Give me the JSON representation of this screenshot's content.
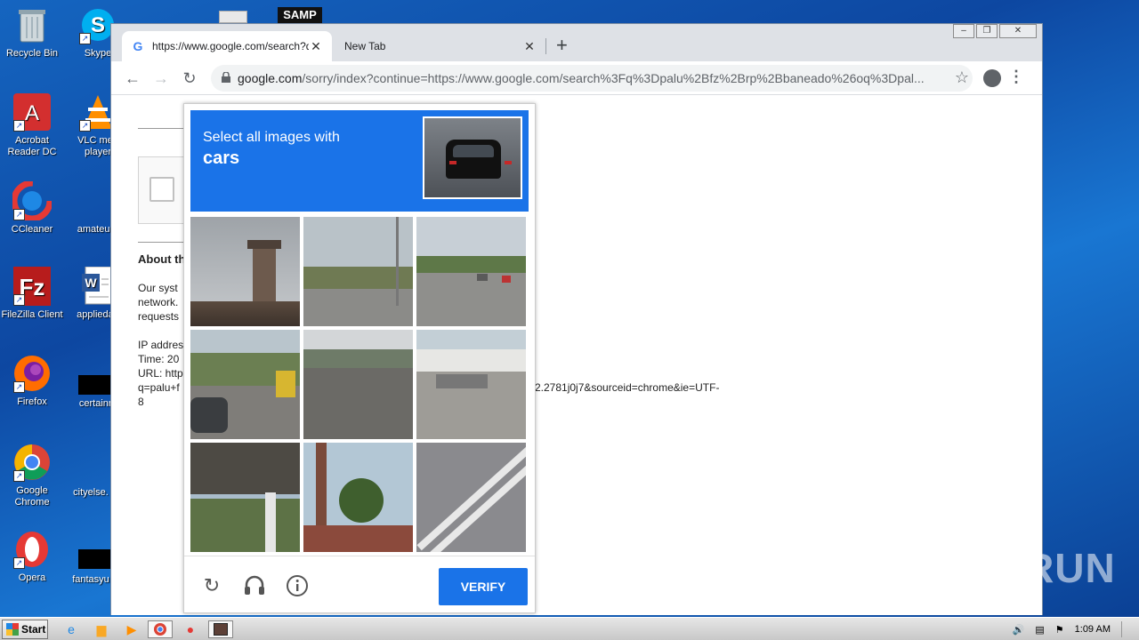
{
  "desktop": {
    "icons": [
      {
        "label": "Recycle Bin",
        "icon": "recycle-bin-icon"
      },
      {
        "label": "Skype",
        "icon": "skype-icon"
      },
      {
        "label": "Acrobat Reader DC",
        "label_line1": "Acrobat",
        "label_line2": "Reader DC",
        "icon": "acrobat-icon"
      },
      {
        "label": "VLC media player",
        "label_line1": "VLC med",
        "label_line2": "player",
        "icon": "vlc-icon"
      },
      {
        "label": "CCleaner",
        "icon": "ccleaner-icon"
      },
      {
        "label": "amateurn",
        "icon": "file-icon"
      },
      {
        "label": "FileZilla Client",
        "icon": "filezilla-icon"
      },
      {
        "label": "appliedag",
        "icon": "word-doc-icon"
      },
      {
        "label": "Firefox",
        "icon": "firefox-icon"
      },
      {
        "label": "certainm",
        "icon": "file-icon"
      },
      {
        "label": "Google Chrome",
        "label_line1": "Google",
        "label_line2": "Chrome",
        "icon": "chrome-icon"
      },
      {
        "label": "cityelse.",
        "icon": "file-icon"
      },
      {
        "label": "Opera",
        "icon": "opera-icon"
      },
      {
        "label": "fantasyu",
        "icon": "file-icon"
      },
      {
        "label": "SAMP",
        "icon": "samp-icon"
      }
    ]
  },
  "browser": {
    "tabs": [
      {
        "title": "https://www.google.com/search?q=",
        "active": true
      },
      {
        "title": "New Tab",
        "active": false
      }
    ],
    "url": {
      "host": "google.com",
      "path": "/sorry/index?continue=https://www.google.com/search%3Fq%3Dpalu%2Bfz%2Brp%2Bbaneado%26oq%3Dpal..."
    }
  },
  "page": {
    "about_heading": "About th",
    "para_lines": [
      "Our syst",
      "network.",
      "requests"
    ],
    "info_lines": [
      "IP addres",
      "Time: 20",
      "URL: http",
      "q=palu+f",
      "8"
    ],
    "url_tail": "2.2781j0j7&sourceid=chrome&ie=UTF-"
  },
  "captcha": {
    "instruction": "Select all images with",
    "target": "cars",
    "verify_label": "VERIFY",
    "header_color": "#1a73e8"
  },
  "watermark": "ANY RUN",
  "taskbar": {
    "start_label": "Start",
    "clock": "1:09 AM"
  }
}
